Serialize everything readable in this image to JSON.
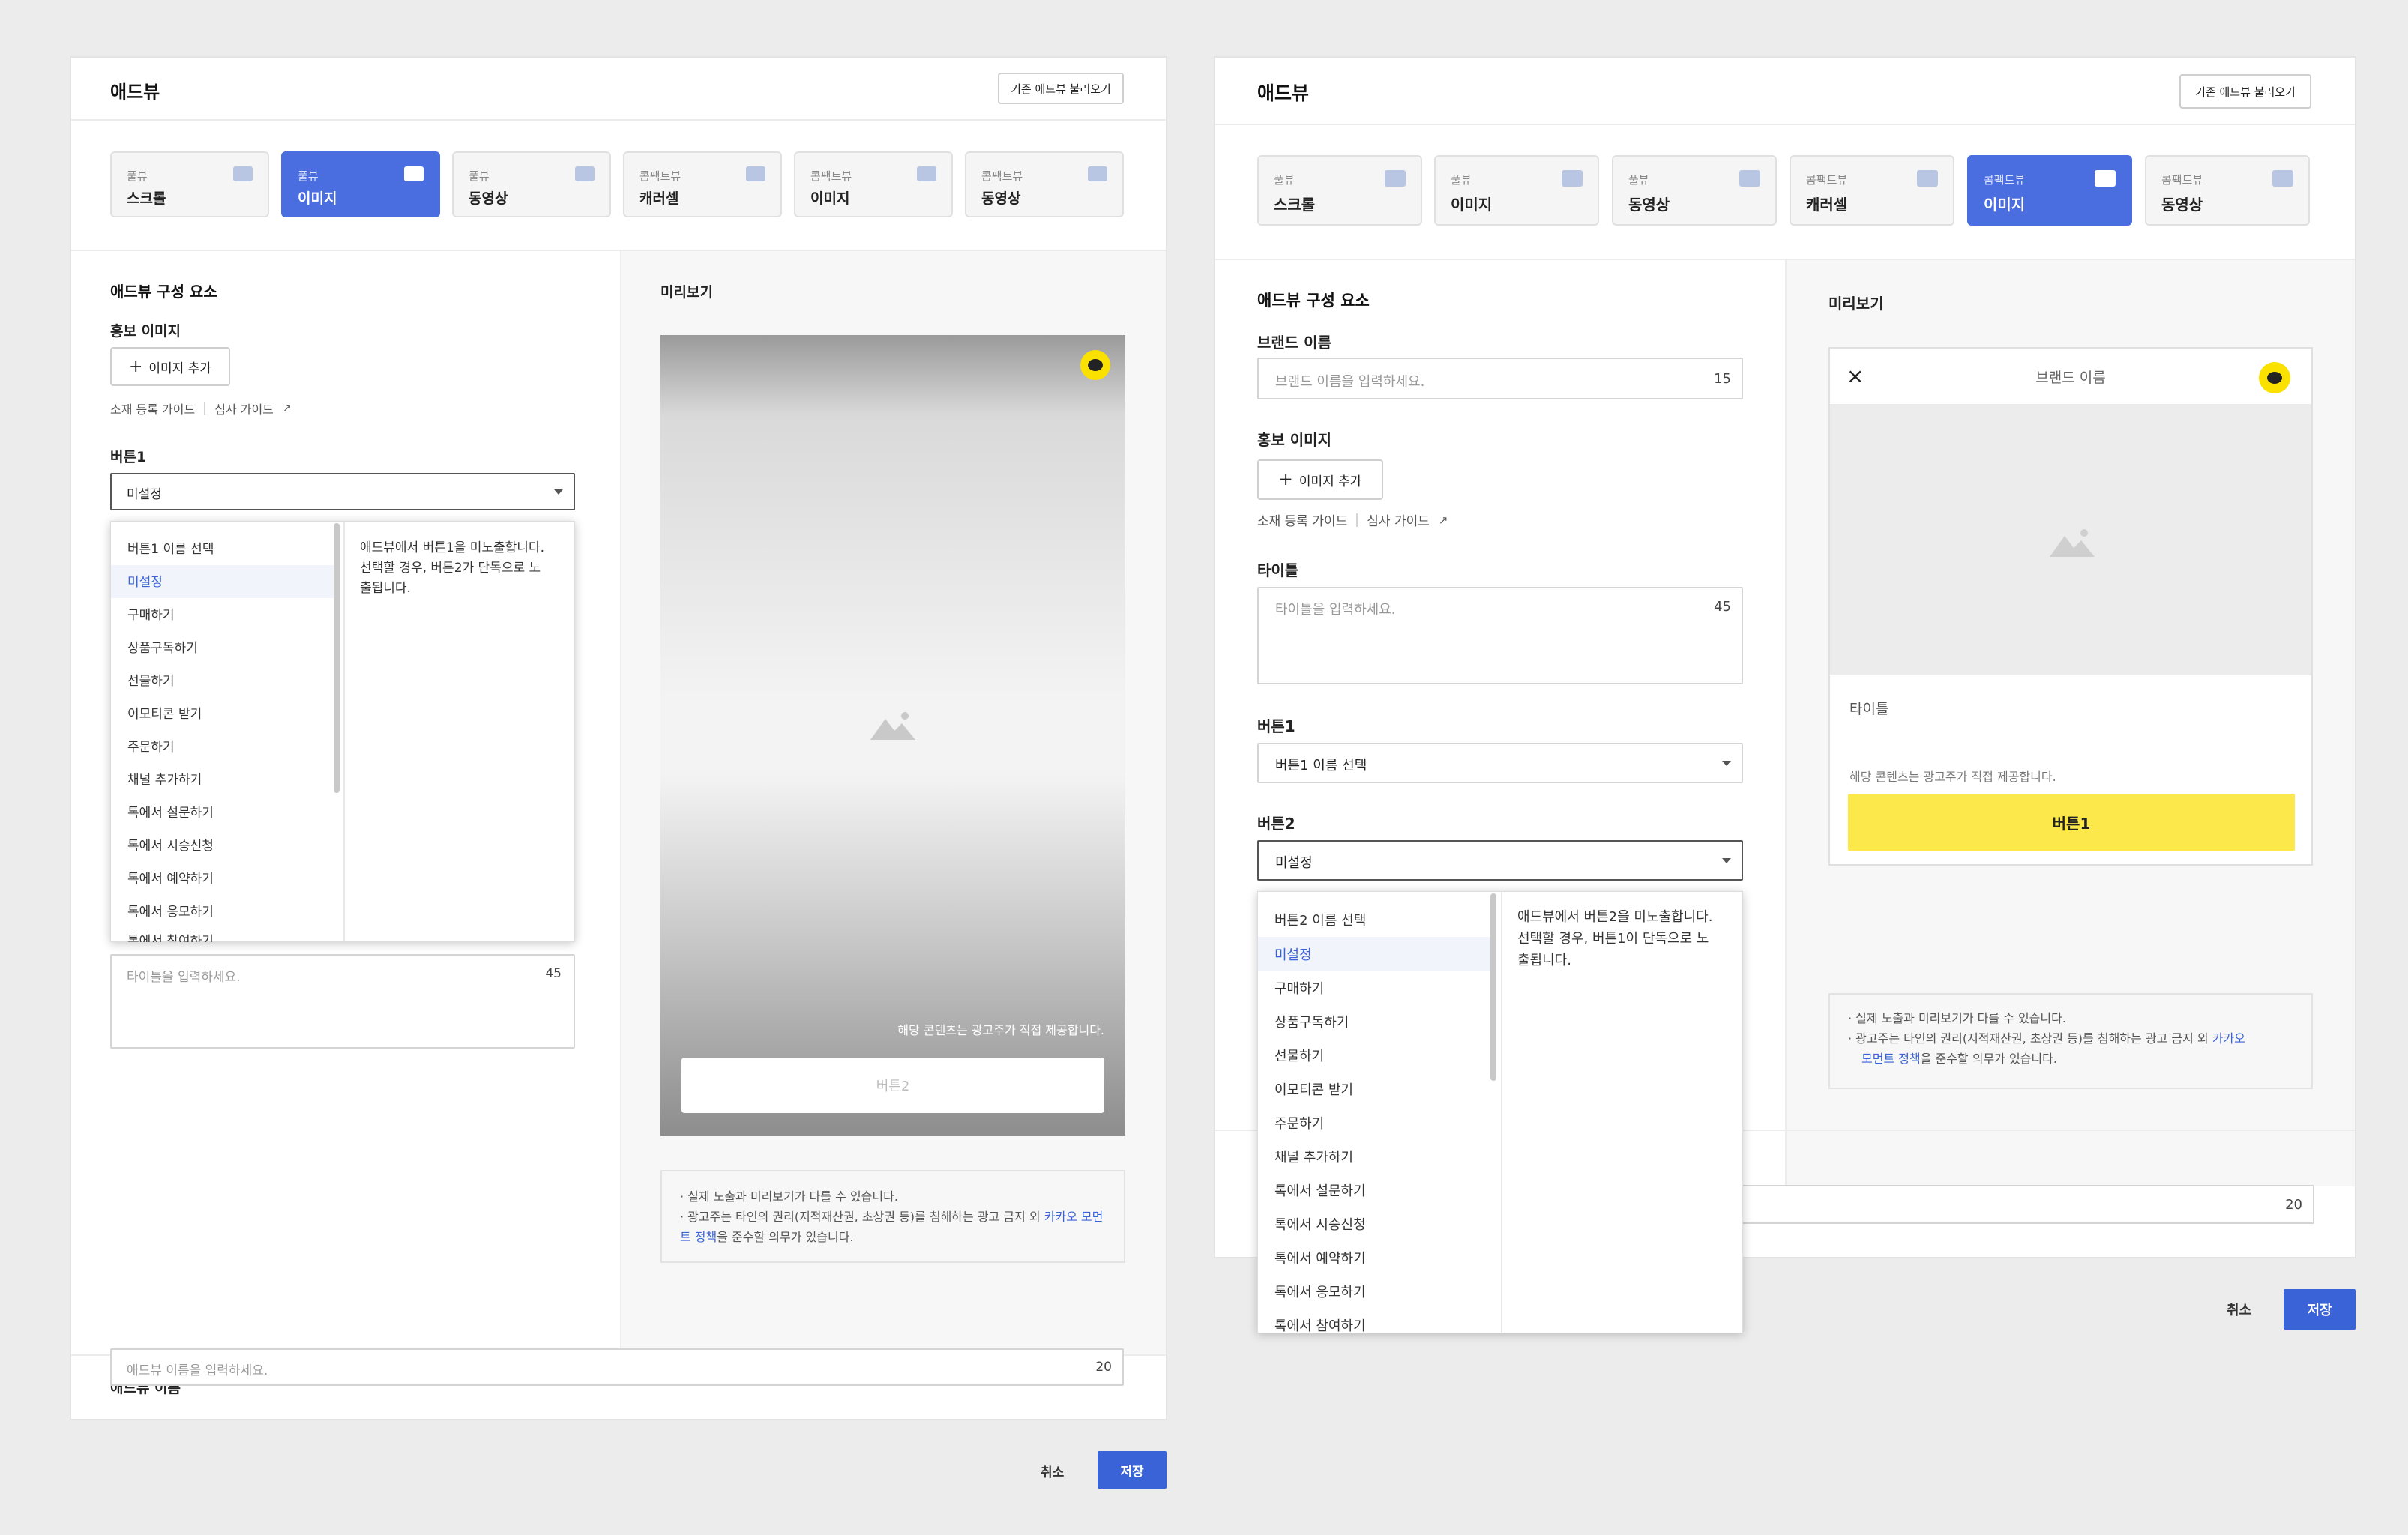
{
  "left": {
    "header_title": "애드뷰",
    "load_button": "기존 애드뷰 불러오기",
    "tabs": [
      {
        "category": "풀뷰",
        "name": "스크롤",
        "icon": "image-icon"
      },
      {
        "category": "풀뷰",
        "name": "이미지",
        "icon": "image-icon"
      },
      {
        "category": "풀뷰",
        "name": "동영상",
        "icon": "video-icon"
      },
      {
        "category": "콤팩트뷰",
        "name": "캐러셀",
        "icon": "image-icon"
      },
      {
        "category": "콤팩트뷰",
        "name": "이미지",
        "icon": "image-icon"
      },
      {
        "category": "콤팩트뷰",
        "name": "동영상",
        "icon": "video-icon"
      }
    ],
    "section_title": "애드뷰 구성 요소",
    "promo_label": "홍보 이미지",
    "add_image": "이미지 추가",
    "guide_1": "소재 등록 가이드",
    "guide_2": "심사 가이드",
    "button1_label": "버튼1",
    "button1_value": "미설정",
    "dropdown": {
      "options": [
        "버튼1 이름 선택",
        "미설정",
        "구매하기",
        "상품구독하기",
        "선물하기",
        "이모티콘 받기",
        "주문하기",
        "채널 추가하기",
        "톡에서 설문하기",
        "톡에서 시승신청",
        "톡에서 예약하기",
        "톡에서 응모하기",
        "톡에서 참여하기"
      ],
      "note": [
        "애드뷰에서 버튼1을 미노출합니다.",
        "선택할 경우, 버튼2가 단독으로 노",
        "출됩니다."
      ]
    },
    "title_placeholder": "타이틀을 입력하세요.",
    "title_count": "45",
    "preview_label": "미리보기",
    "preview_caption": "해당 콘텐츠는 광고주가 직접 제공합니다.",
    "preview_button": "버튼2",
    "disclaimer_1": "· 실제 노출과 미리보기가 다를 수 있습니다.",
    "disclaimer_2a": "· 광고주는 타인의 권리(지적재산권, 초상권 등)를 침해하는 광고 금지 외 ",
    "disclaimer_link": "카카오 모먼트 정책",
    "disclaimer_2b": "을 준수할 의무가 있습니다.",
    "name_label": "애드뷰 이름",
    "name_placeholder": "애드뷰 이름을 입력하세요.",
    "name_count": "20",
    "cancel": "취소",
    "save": "저장"
  },
  "right": {
    "header_title": "애드뷰",
    "load_button": "기존 애드뷰 불러오기",
    "tabs": [
      {
        "category": "풀뷰",
        "name": "스크롤",
        "icon": "image-icon"
      },
      {
        "category": "풀뷰",
        "name": "이미지",
        "icon": "image-icon"
      },
      {
        "category": "풀뷰",
        "name": "동영상",
        "icon": "video-icon"
      },
      {
        "category": "콤팩트뷰",
        "name": "캐러셀",
        "icon": "image-icon"
      },
      {
        "category": "콤팩트뷰",
        "name": "이미지",
        "icon": "image-icon"
      },
      {
        "category": "콤팩트뷰",
        "name": "동영상",
        "icon": "video-icon"
      }
    ],
    "section_title": "애드뷰 구성 요소",
    "brand_label": "브랜드 이름",
    "brand_placeholder": "브랜드 이름을 입력하세요.",
    "brand_count": "15",
    "promo_label": "홍보 이미지",
    "add_image": "이미지 추가",
    "guide_1": "소재 등록 가이드",
    "guide_2": "심사 가이드",
    "title_label": "타이틀",
    "title_placeholder": "타이틀을 입력하세요.",
    "title_count": "45",
    "button1_label": "버튼1",
    "button1_value": "버튼1 이름 선택",
    "button2_label": "버튼2",
    "button2_value": "미설정",
    "dropdown": {
      "options": [
        "버튼2 이름 선택",
        "미설정",
        "구매하기",
        "상품구독하기",
        "선물하기",
        "이모티콘 받기",
        "주문하기",
        "채널 추가하기",
        "톡에서 설문하기",
        "톡에서 시승신청",
        "톡에서 예약하기",
        "톡에서 응모하기",
        "톡에서 참여하기"
      ],
      "note": [
        "애드뷰에서 버튼2을 미노출합니다.",
        "선택할 경우, 버튼1이 단독으로 노",
        "출됩니다."
      ]
    },
    "preview_label": "미리보기",
    "preview_brand": "브랜드 이름",
    "preview_title": "타이틀",
    "preview_caption": "해당 콘텐츠는 광고주가 직접 제공합니다.",
    "preview_button": "버튼1",
    "disclaimer_1": "· 실제 노출과 미리보기가 다를 수 있습니다.",
    "disclaimer_2a": "· 광고주는 타인의 권리(지적재산권, 초상권 등)를 침해하는 광고 금지 외 ",
    "disclaimer_link_a": "카카오",
    "disclaimer_link_b": "모먼트 정책",
    "disclaimer_2b": "을 준수할 의무가 있습니다.",
    "name_count": "20",
    "cancel": "취소",
    "save": "저장"
  },
  "colors": {
    "accent": "#3a63d8",
    "tab_active": "#4a6ee0",
    "kakao_yellow": "#fae100",
    "button_yellow": "#fce84b"
  }
}
